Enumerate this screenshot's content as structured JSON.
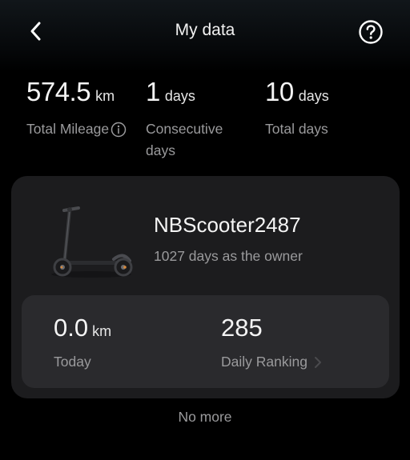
{
  "header": {
    "title": "My data",
    "back_icon": "chevron-left-icon",
    "help_icon": "question-circle-icon"
  },
  "stats": {
    "total_mileage": {
      "value": "574.5",
      "unit": "km",
      "label": "Total Mileage",
      "icon": "info-icon"
    },
    "consecutive": {
      "value": "1",
      "unit": "days",
      "label": "Consecutive days"
    },
    "total_days": {
      "value": "10",
      "unit": "days",
      "label": "Total days"
    }
  },
  "device": {
    "name": "NBScooter2487",
    "owner_text": "1027 days as the owner",
    "image_icon": "scooter-image"
  },
  "today": {
    "value": "0.0",
    "unit": "km",
    "label": "Today"
  },
  "ranking": {
    "value": "285",
    "label": "Daily Ranking",
    "icon": "chevron-right-icon"
  },
  "footer": {
    "text": "No more"
  },
  "colors": {
    "background": "#000000",
    "card": "#1c1c1e",
    "inner_card": "#2a2a2d",
    "secondary_text": "#9a9a9c"
  }
}
